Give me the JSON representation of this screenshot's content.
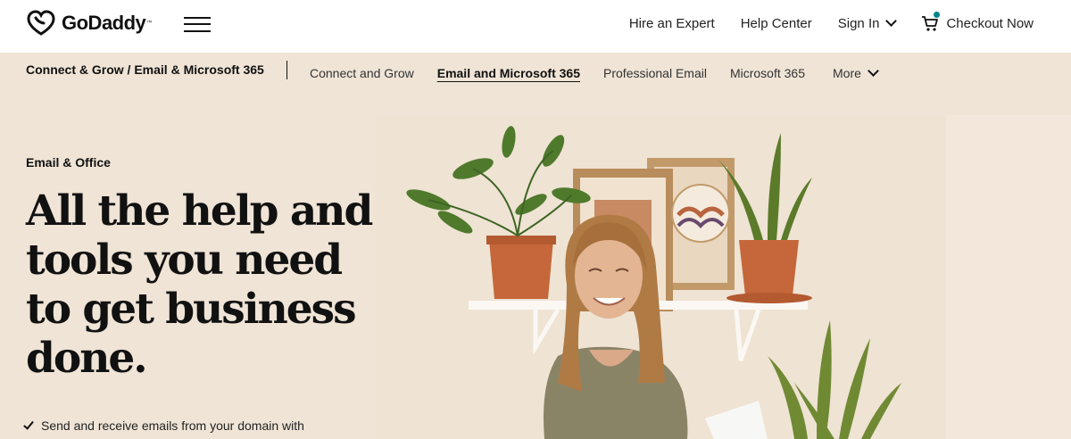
{
  "header": {
    "logo_text": "GoDaddy",
    "logo_tm": "™",
    "links": {
      "hire_expert": "Hire an Expert",
      "help_center": "Help Center",
      "sign_in": "Sign In",
      "checkout": "Checkout Now"
    },
    "cart_dot_color": "#00838c"
  },
  "subnav": {
    "breadcrumb": "Connect & Grow / Email & Microsoft 365",
    "items": [
      {
        "label": "Connect and Grow"
      },
      {
        "label": "Email and Microsoft 365"
      },
      {
        "label": "Professional Email"
      },
      {
        "label": "Microsoft 365"
      },
      {
        "label": "More"
      }
    ],
    "active_item": "Email and Microsoft 365"
  },
  "hero": {
    "eyebrow": "Email & Office",
    "headline": "All the help and tools you need to get business done.",
    "bullets": [
      {
        "text": "Send and receive emails from your domain with"
      }
    ],
    "background": "#efe4d6"
  }
}
